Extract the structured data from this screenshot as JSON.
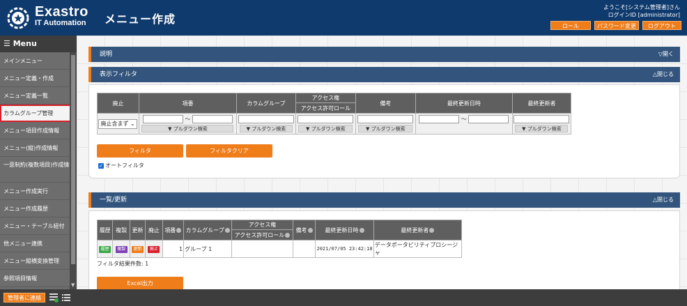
{
  "header": {
    "logo_word": "Exastro",
    "logo_sub": "IT Automation",
    "title": "メニュー作成",
    "welcome": "ようこそ[システム管理者]さん",
    "login_id": "ログインID [administrator]",
    "buttons": {
      "role": "ロール",
      "password": "パスワード変更",
      "logout": "ログアウト"
    },
    "brand_color": "#0f3a6d",
    "accent_color": "#ef7d1a"
  },
  "sidebar": {
    "title": "Menu",
    "items": [
      {
        "label": "メインメニュー"
      },
      {
        "label": "メニュー定義・作成"
      },
      {
        "label": "メニュー定義一覧"
      },
      {
        "label": "カラムグループ管理"
      },
      {
        "label": "メニュー項目作成情報"
      },
      {
        "label": "メニュー(縦)作成情報"
      },
      {
        "label": "一意制約(複数項目)作成情報"
      },
      {
        "label": "メニュー作成実行"
      },
      {
        "label": "メニュー作成履歴"
      },
      {
        "label": "メニュー・テーブル紐付"
      },
      {
        "label": "他メニュー連携"
      },
      {
        "label": "メニュー縦横変換管理"
      },
      {
        "label": "参照項目情報"
      }
    ]
  },
  "sections": {
    "description": {
      "title": "説明",
      "toggle": "▽開く"
    },
    "filter": {
      "title": "表示フィルタ",
      "toggle": "△閉じる"
    },
    "list": {
      "title": "一覧/更新",
      "toggle": "△閉じる"
    }
  },
  "filter_table": {
    "headers": {
      "disuse": "廃止",
      "item_no": "項番",
      "column_group": "カラムグループ",
      "access_right": "アクセス権",
      "access_role": "アクセス許可ロール",
      "remarks": "備考",
      "last_updated": "最終更新日時",
      "last_updater": "最終更新者"
    },
    "disuse_select": "廃止含まず",
    "range_sep": "〜",
    "pulldown": "▼ プルダウン検索"
  },
  "filter_buttons": {
    "filter": "フィルタ",
    "clear": "フィルタクリア"
  },
  "auto_filter": "オートフィルタ",
  "result_table": {
    "headers": {
      "history": "履歴",
      "copy": "複製",
      "update": "更新",
      "disuse": "廃止",
      "item_no": "項番",
      "column_group": "カラムグループ",
      "access_right": "アクセス権",
      "access_role": "アクセス許可ロール",
      "remarks": "備考",
      "last_updated": "最終更新日時",
      "last_updater": "最終更新者"
    },
    "row": {
      "btn_history": "履歴",
      "btn_copy": "複製",
      "btn_update": "更新",
      "btn_disuse": "廃止",
      "item_no": "1",
      "column_group": "グループ 1",
      "access_role": "",
      "remarks": "",
      "last_updated": "2021/07/05 23:42:18",
      "last_updater": "データポータビリティプロシージャ"
    },
    "count_text": "フィルタ結果件数: 1"
  },
  "excel_button": "Excel出力",
  "footer": {
    "contact": "管理者に連絡"
  }
}
